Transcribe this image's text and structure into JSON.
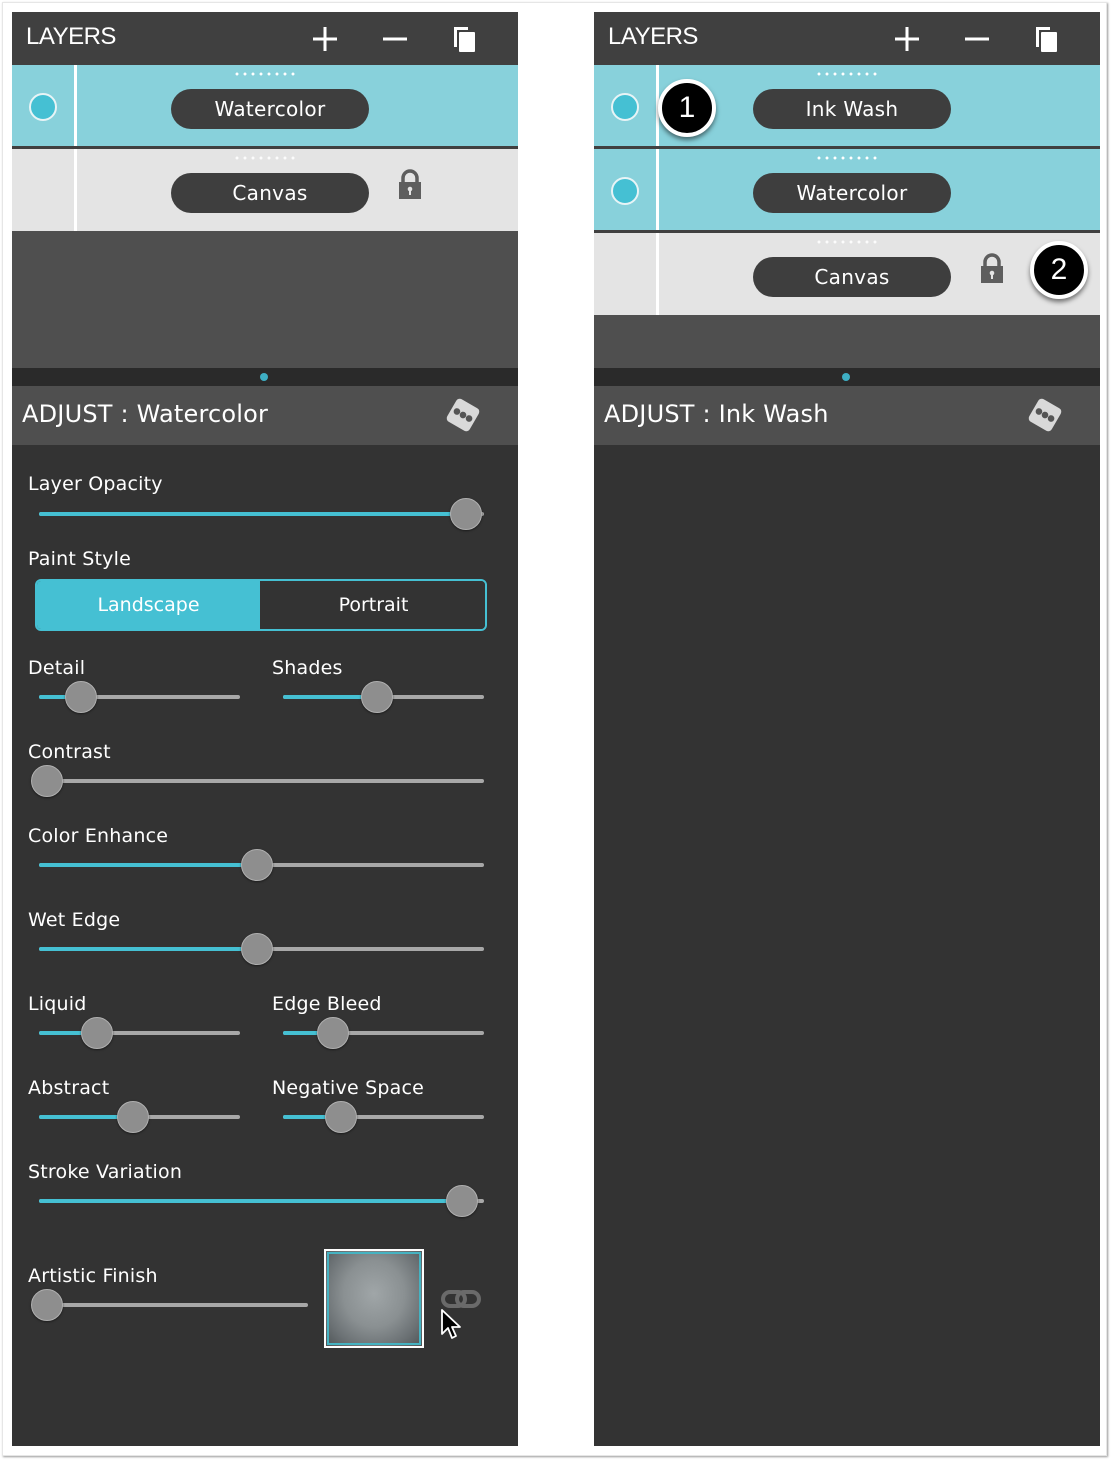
{
  "colors": {
    "accent": "#45c0d3",
    "active_layer_bg": "#88d1db",
    "inactive_layer_bg": "#e4e4e4",
    "header_bg": "#404040",
    "panel_bg": "#333333"
  },
  "left_panel": {
    "layers": {
      "title": "LAYERS",
      "add_icon": "plus-icon",
      "remove_icon": "minus-icon",
      "duplicate_icon": "duplicate-icon",
      "items": [
        {
          "name": "Watercolor",
          "active": true,
          "visible": true,
          "locked": false
        },
        {
          "name": "Canvas",
          "active": false,
          "visible": false,
          "locked": true
        }
      ]
    },
    "adjust": {
      "title": "ADJUST : Watercolor",
      "randomize_icon": "dice-icon",
      "controls": {
        "layer_opacity": {
          "label": "Layer Opacity",
          "value": 0.96
        },
        "paint_style": {
          "label": "Paint Style",
          "options": [
            "Landscape",
            "Portrait"
          ],
          "selected": "Landscape"
        },
        "detail": {
          "label": "Detail",
          "value": 0.21
        },
        "shades": {
          "label": "Shades",
          "value": 0.47
        },
        "contrast": {
          "label": "Contrast",
          "value": 0.0
        },
        "color_enhance": {
          "label": "Color Enhance",
          "value": 0.49
        },
        "wet_edge": {
          "label": "Wet Edge",
          "value": 0.49
        },
        "liquid": {
          "label": "Liquid",
          "value": 0.29
        },
        "edge_bleed": {
          "label": "Edge Bleed",
          "value": 0.25
        },
        "abstract": {
          "label": "Abstract",
          "value": 0.47
        },
        "negative_space": {
          "label": "Negative Space",
          "value": 0.29
        },
        "stroke_variation": {
          "label": "Stroke Variation",
          "value": 0.95
        },
        "artistic_finish": {
          "label": "Artistic Finish",
          "value": 0.0,
          "texture_icon": "texture-swatch",
          "link_icon": "link-icon"
        }
      }
    }
  },
  "right_panel": {
    "layers": {
      "title": "LAYERS",
      "items": [
        {
          "name": "Ink Wash",
          "active": true,
          "visible": true,
          "locked": false
        },
        {
          "name": "Watercolor",
          "active": true,
          "visible": true,
          "locked": false
        },
        {
          "name": "Canvas",
          "active": false,
          "visible": false,
          "locked": true
        }
      ]
    },
    "adjust": {
      "title": "ADJUST : Ink Wash"
    },
    "callouts": [
      "1",
      "2"
    ]
  }
}
